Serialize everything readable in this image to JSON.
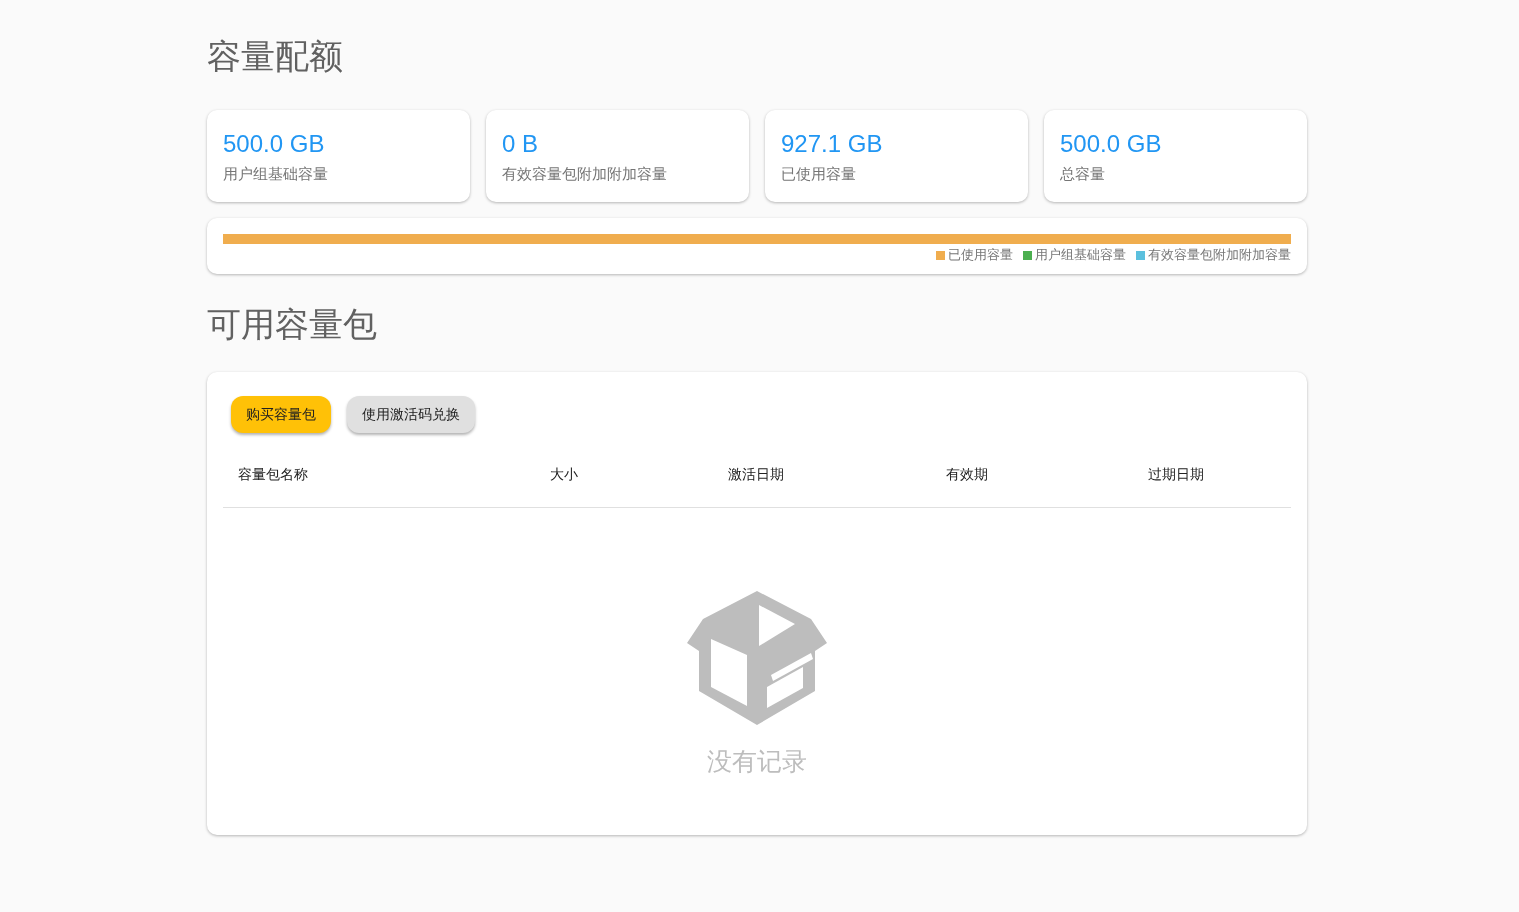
{
  "quota": {
    "title": "容量配额",
    "stats": [
      {
        "value": "500.0 GB",
        "label": "用户组基础容量"
      },
      {
        "value": "0 B",
        "label": "有效容量包附加附加容量"
      },
      {
        "value": "927.1 GB",
        "label": "已使用容量"
      },
      {
        "value": "500.0 GB",
        "label": "总容量"
      }
    ],
    "usage_bar": {
      "level": 1,
      "color": "#f0ad4e"
    },
    "legend": [
      {
        "label": "已使用容量",
        "color": "#f0ad4e"
      },
      {
        "label": "用户组基础容量",
        "color": "#4caf50"
      },
      {
        "label": "有效容量包附加附加容量",
        "color": "#5bc0de"
      }
    ]
  },
  "packs": {
    "title": "可用容量包",
    "buttons": [
      {
        "label": "购买容量包",
        "kind": "primary"
      },
      {
        "label": "使用激活码兑换",
        "kind": "secondary"
      }
    ],
    "table": {
      "columns": [
        "容量包名称",
        "大小",
        "激活日期",
        "有效期",
        "过期日期"
      ]
    },
    "empty": {
      "text": "没有记录"
    }
  }
}
